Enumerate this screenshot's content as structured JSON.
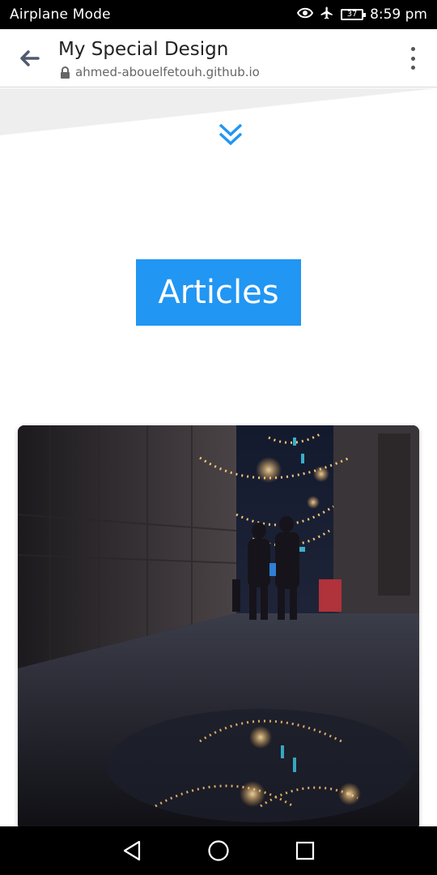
{
  "status_bar": {
    "mode_label": "Airplane Mode",
    "battery": "37",
    "time": "8:59 pm"
  },
  "browser": {
    "title": "My Special Design",
    "url": "ahmed-abouelfetouh.github.io"
  },
  "page": {
    "section_title": "Articles",
    "accent_color": "#2196f3"
  }
}
